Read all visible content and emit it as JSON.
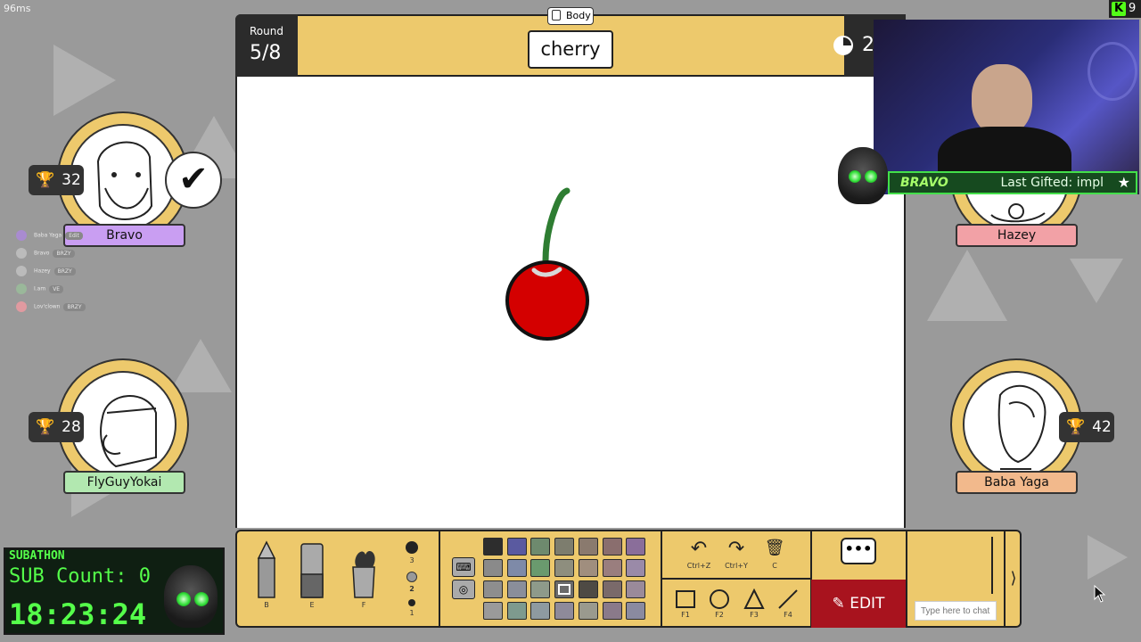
{
  "overlay": {
    "ping": "96ms",
    "kick_count": "9",
    "last_gifted": "Last Gifted: impl",
    "gifted_name": "BRAVO"
  },
  "game": {
    "round_label": "Round",
    "round_value": "5/8",
    "category": "Body",
    "word": "cherry",
    "timer_partial": "2"
  },
  "players": [
    {
      "name": "Bravo",
      "score": "32",
      "plate_color": "#c99ef2",
      "guessed": true
    },
    {
      "name": "Hazey",
      "score": "",
      "plate_color": "#f2a1a6"
    },
    {
      "name": "FlyGuyYokai",
      "score": "28",
      "plate_color": "#b2e8b0"
    },
    {
      "name": "Baba Yaga",
      "score": "42",
      "plate_color": "#f2b98c"
    }
  ],
  "mini_list": [
    {
      "name": "Baba Yaga",
      "tag": "Edit"
    },
    {
      "name": "Bravo",
      "tag": "BRZY"
    },
    {
      "name": "Hazey",
      "tag": "BRZY"
    },
    {
      "name": "I.am",
      "tag": "VE"
    },
    {
      "name": "Lov'clown",
      "tag": "BRZY"
    }
  ],
  "subathon": {
    "title": "SUBATHON",
    "count": "SUB Count: 0",
    "time": "18:23:24"
  },
  "tools": [
    {
      "name": "pencil",
      "key": "B"
    },
    {
      "name": "eraser",
      "key": "E"
    },
    {
      "name": "fill",
      "key": "F"
    }
  ],
  "brush_sizes": [
    "3",
    "2",
    "1"
  ],
  "palette": [
    "#2d2d2d",
    "#5a5aa0",
    "#6e8a6e",
    "#7d7d6e",
    "#8a7a6e",
    "#8a6e6e",
    "#8a6e9a",
    "#8a8a8a",
    "#7e8aa8",
    "#6a9a6e",
    "#8e8e7e",
    "#a08e7e",
    "#9a7e7e",
    "#9a8aa8",
    "#8e8e8e",
    "#8a8e9a",
    "#8e9a8a",
    "#6a6a6a",
    "#4e4a44",
    "#7a6a6a",
    "#9a8a9a",
    "#9a9a9a",
    "#7e9a8e",
    "#8e9aa0",
    "#8e8a9a",
    "#9a9a8e",
    "#8a7a8a",
    "#8a8aa0"
  ],
  "actions": [
    {
      "name": "undo",
      "glyph": "↶",
      "label": "Ctrl+Z"
    },
    {
      "name": "redo",
      "glyph": "↷",
      "label": "Ctrl+Y"
    },
    {
      "name": "clear",
      "glyph": "🗑",
      "label": "C"
    }
  ],
  "shapes": [
    {
      "name": "rectangle",
      "label": "F1"
    },
    {
      "name": "circle",
      "label": "F2"
    },
    {
      "name": "triangle",
      "label": "F3"
    },
    {
      "name": "line",
      "label": "F4"
    }
  ],
  "edit_label": "EDIT",
  "chat": {
    "placeholder": "Type here to chat"
  },
  "colors": {
    "board_yellow": "#edc96c",
    "edit_red": "#a8131e",
    "cherry_red": "#d40000",
    "stem_green": "#2e7d32"
  }
}
